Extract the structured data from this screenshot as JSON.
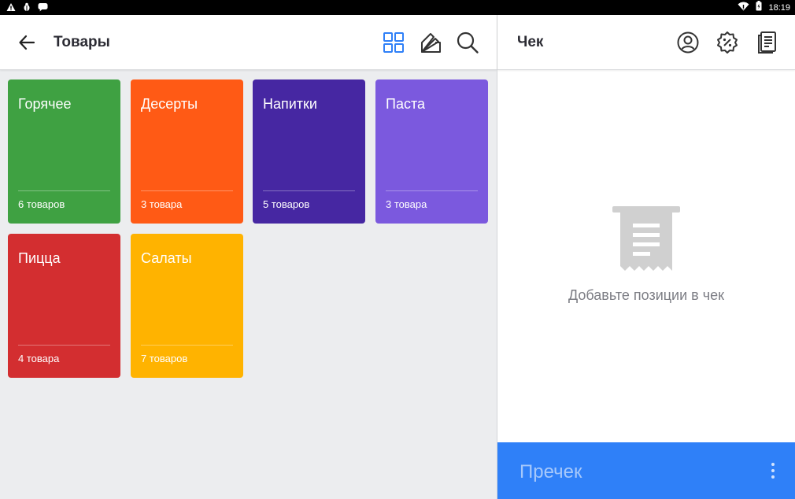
{
  "status_bar": {
    "time": "18:19",
    "icons": [
      "warning-icon",
      "bug-icon",
      "message-icon",
      "wifi-icon",
      "battery-icon"
    ]
  },
  "products": {
    "title": "Товары",
    "header_icons": [
      "grid-view-icon",
      "palette-icon",
      "search-icon"
    ],
    "categories": [
      {
        "name": "Горячее",
        "count": "6 товаров",
        "color": "#3fa142"
      },
      {
        "name": "Десерты",
        "count": "3 товара",
        "color": "#ff5a15"
      },
      {
        "name": "Напитки",
        "count": "5 товаров",
        "color": "#4627a2"
      },
      {
        "name": "Паста",
        "count": "3 товара",
        "color": "#7b59de"
      },
      {
        "name": "Пицца",
        "count": "4 товара",
        "color": "#d32e30"
      },
      {
        "name": "Салаты",
        "count": "7 товаров",
        "color": "#ffb300"
      }
    ]
  },
  "receipt": {
    "title": "Чек",
    "header_icons": [
      "customer-icon",
      "discount-icon",
      "receipt-list-icon"
    ],
    "empty_message": "Добавьте позиции в чек",
    "precheck_label": "Пречек",
    "accent_color": "#2f80f8"
  }
}
